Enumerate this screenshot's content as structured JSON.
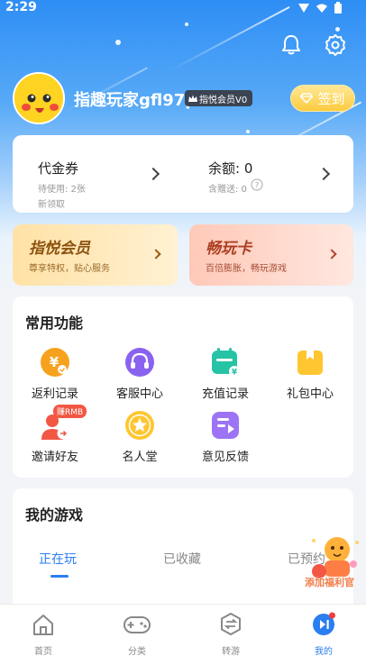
{
  "status_bar": {
    "time": "2:29"
  },
  "top_actions": {
    "notification_icon": "bell-icon",
    "settings_icon": "gear-icon"
  },
  "profile": {
    "username": "指趣玩家gfl97p",
    "vip_badge": "指悦会员V0",
    "checkin_label": "签到"
  },
  "wallet": {
    "voucher": {
      "title": "代金券",
      "pending": "待使用: 2张",
      "new": "新领取"
    },
    "balance": {
      "title": "余额: 0",
      "gift": "含赠送: 0"
    }
  },
  "promos": [
    {
      "title": "指悦会员",
      "subtitle": "尊享特权，贴心服务",
      "color": "#9a5a12"
    },
    {
      "title": "畅玩卡",
      "subtitle": "百倍膨胀，畅玩游戏",
      "color": "#b4452a"
    }
  ],
  "common_functions": {
    "title": "常用功能",
    "items": [
      {
        "label": "返利记录",
        "icon": "rebate-icon"
      },
      {
        "label": "客服中心",
        "icon": "headset-icon"
      },
      {
        "label": "充值记录",
        "icon": "recharge-icon"
      },
      {
        "label": "礼包中心",
        "icon": "gift-icon"
      },
      {
        "label": "邀请好友",
        "icon": "invite-friends-icon",
        "badge": "赚RMB"
      },
      {
        "label": "名人堂",
        "icon": "star-icon"
      },
      {
        "label": "意见反馈",
        "icon": "feedback-icon"
      }
    ]
  },
  "my_games": {
    "title": "我的游戏",
    "tabs": [
      "正在玩",
      "已收藏",
      "已预约"
    ],
    "active_tab": 0
  },
  "float_ad": {
    "label": "添加福利官"
  },
  "bottom_nav": {
    "items": [
      {
        "label": "首页",
        "icon": "home-icon"
      },
      {
        "label": "分类",
        "icon": "gamepad-icon"
      },
      {
        "label": "转游",
        "icon": "transfer-icon"
      },
      {
        "label": "我的",
        "icon": "profile-icon"
      }
    ],
    "active": 3
  },
  "colors": {
    "accent": "#2a7ef0",
    "gold": "#fccc3f"
  }
}
